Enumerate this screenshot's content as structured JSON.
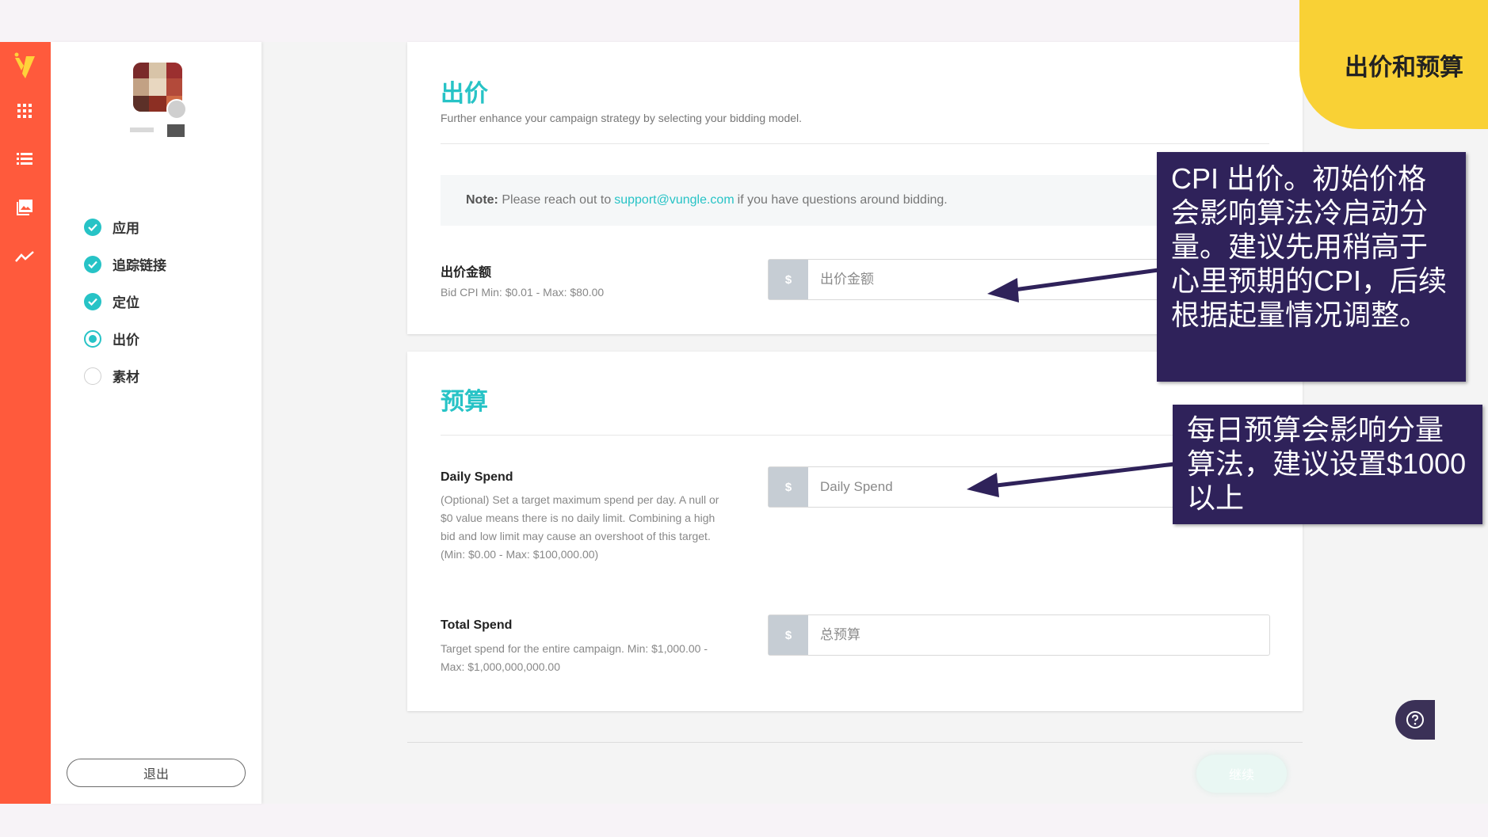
{
  "corner_tab": {
    "title": "出价和预算"
  },
  "sidebar": {
    "steps": [
      {
        "label": "应用",
        "state": "done"
      },
      {
        "label": "追踪链接",
        "state": "done"
      },
      {
        "label": "定位",
        "state": "done"
      },
      {
        "label": "出价",
        "state": "active"
      },
      {
        "label": "素材",
        "state": "todo"
      }
    ],
    "logout_label": "退出"
  },
  "bidding": {
    "title": "出价",
    "subtitle": "Further enhance your campaign strategy by selecting your bidding model.",
    "note_prefix": "Note:",
    "note_text": "Please reach out to",
    "note_link": "support@vungle.com",
    "note_suffix": "if you have questions around bidding.",
    "bid_label": "出价金额",
    "bid_help": "Bid CPI Min: $0.01 - Max: $80.00",
    "currency": "$",
    "bid_placeholder": "出价金额"
  },
  "budget": {
    "title": "预算",
    "daily_label": "Daily Spend",
    "daily_help": "(Optional) Set a target maximum spend per day. A null or $0 value means there is no daily limit. Combining a high bid and low limit may cause an overshoot of this target. (Min: $0.00 - Max: $100,000.00)",
    "daily_placeholder": "Daily Spend",
    "total_label": "Total Spend",
    "total_help": "Target spend for the entire campaign. Min: $1,000.00 - Max: $1,000,000,000.00",
    "total_placeholder": "总预算"
  },
  "actions": {
    "continue_label": "继续"
  },
  "callouts": {
    "bid_tip": "CPI 出价。初始价格会影响算法冷启动分量。建议先用稍高于心里预期的CPI，后续根据起量情况调整。",
    "budget_tip": "每日预算会影响分量算法，建议设置$1000以上"
  },
  "colors": {
    "accent": "#27c3c6",
    "rail": "#ff5a3c",
    "tab": "#f9d135",
    "callout": "#2f225a"
  }
}
